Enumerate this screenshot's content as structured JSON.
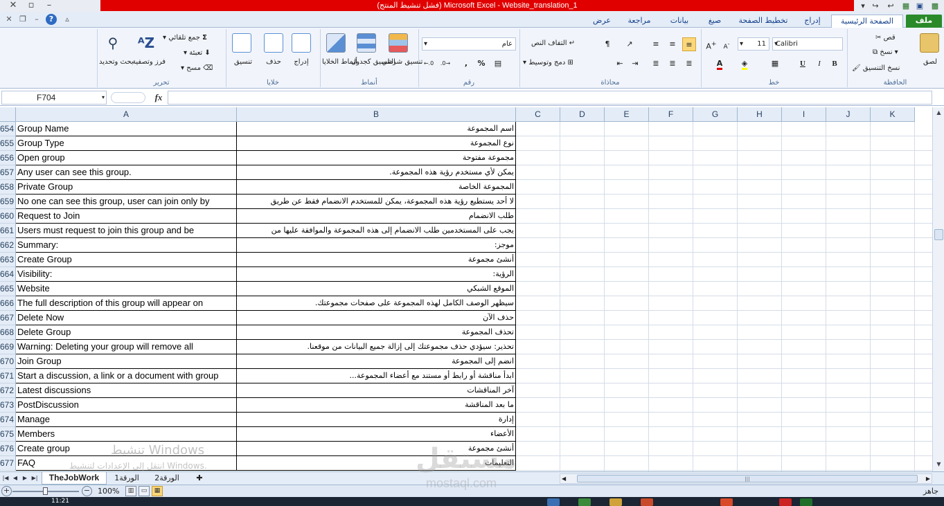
{
  "window": {
    "title": "(فشل تنشيط المنتج) Microsoft Excel - Website_translation_1",
    "minimize": "–",
    "restore": "▫",
    "close": "✕"
  },
  "tabs": {
    "file": "ملف",
    "home": "الصفحة الرئيسية",
    "insert": "إدراج",
    "page_layout": "تخطيط الصفحة",
    "formulas": "صيغ",
    "data": "بيانات",
    "review": "مراجعة",
    "view": "عرض"
  },
  "ribbon": {
    "clipboard": {
      "label": "الحافظة",
      "paste": "لصق",
      "cut": "قص",
      "copy": "نسخ",
      "format_painter": "نسخ التنسيق"
    },
    "font": {
      "label": "خط",
      "font_name": "Calibri",
      "font_size": "11",
      "bold": "B",
      "italic": "I",
      "underline": "U"
    },
    "alignment": {
      "label": "محاذاة",
      "wrap_text": "التفاف النص",
      "merge_center": "دمج وتوسيط"
    },
    "number": {
      "label": "رقم",
      "format": "عام",
      "percent": "%",
      "comma": ","
    },
    "styles": {
      "label": "أنماط",
      "conditional": "تنسيق شرطي",
      "format_table": "التنسيق كجدول",
      "cell_styles": "أنماط الخلايا"
    },
    "cells": {
      "label": "خلايا",
      "insert": "إدراج",
      "delete": "حذف",
      "format": "تنسيق"
    },
    "editing": {
      "label": "تحرير",
      "autosum": "جمع تلقائي",
      "fill": "تعبئة",
      "clear": "مسح",
      "sort_filter": "فرز وتصفية",
      "find_select": "بحث وتحديد"
    }
  },
  "formula_bar": {
    "name_box": "F704",
    "fx": "fx",
    "value": ""
  },
  "columns": [
    "A",
    "B",
    "C",
    "D",
    "E",
    "F",
    "G",
    "H",
    "I",
    "J",
    "K"
  ],
  "rows": [
    {
      "num": "654",
      "a": "Group Name",
      "b": "اسم المجموعة"
    },
    {
      "num": "655",
      "a": "Group Type",
      "b": "نوع المجموعة"
    },
    {
      "num": "656",
      "a": "Open group",
      "b": "مجموعة مفتوحة"
    },
    {
      "num": "657",
      "a": "Any user can see this group.",
      "b": "يمكن لأي مستخدم رؤية هذه المجموعة."
    },
    {
      "num": "658",
      "a": "Private Group",
      "b": "المجموعة الخاصة"
    },
    {
      "num": "659",
      "a": "No one can see this group, user can join only by",
      "b": "لا أحد يستطيع رؤية هذه المجموعة، يمكن للمستخدم الانضمام فقط عن طريق"
    },
    {
      "num": "660",
      "a": "Request to Join",
      "b": "طلب الانضمام"
    },
    {
      "num": "661",
      "a": "Users must request to join this group and be",
      "b": "يجب على المستخدمين طلب الانضمام إلى هذه المجموعة والموافقة عليها من"
    },
    {
      "num": "662",
      "a": "Summary:",
      "b": "موجز:"
    },
    {
      "num": "663",
      "a": "Create Group",
      "b": "أنشئ مجموعة"
    },
    {
      "num": "664",
      "a": "Visibility:",
      "b": "الرؤية:"
    },
    {
      "num": "665",
      "a": "Website",
      "b": "الموقع الشبكي"
    },
    {
      "num": "666",
      "a": "The full description of this group will appear on",
      "b": "سيظهر الوصف الكامل لهذه المجموعة على صفحات مجموعتك."
    },
    {
      "num": "667",
      "a": "Delete Now",
      "b": "حذف الآن"
    },
    {
      "num": "668",
      "a": "Delete Group",
      "b": "تحذف المجموعة"
    },
    {
      "num": "669",
      "a": "Warning: Deleting your group will remove all",
      "b": "تحذير: سيؤدي حذف مجموعتك إلى إزالة جميع البيانات من موقعنا."
    },
    {
      "num": "670",
      "a": "Join Group",
      "b": "انضم إلى المجموعة"
    },
    {
      "num": "671",
      "a": "Start a discussion, a link or a document with group",
      "b": "ابدأ مناقشة أو رابط أو مستند مع أعضاء المجموعة..."
    },
    {
      "num": "672",
      "a": "Latest discussions",
      "b": "آخر المناقشات"
    },
    {
      "num": "673",
      "a": "PostDiscussion",
      "b": "ما بعد المناقشة"
    },
    {
      "num": "674",
      "a": "Manage",
      "b": "إدارة"
    },
    {
      "num": "675",
      "a": "Members",
      "b": "الأعضاء"
    },
    {
      "num": "676",
      "a": "Create group",
      "b": "أنشئ مجموعة"
    },
    {
      "num": "677",
      "a": "FAQ",
      "b": "التعليمات"
    }
  ],
  "sheets": {
    "active": "TheJobWork",
    "sheet1": "الورقة1",
    "sheet2": "الورقة2"
  },
  "status": {
    "zoom": "100%",
    "ready": "جاهز",
    "clock": "11:21"
  },
  "watermarks": {
    "activate_title": "تنشيط Windows",
    "activate_sub": "انتقل إلى الإعدادات لتنشيط Windows.",
    "logo": "مستقل",
    "url": "mostaql.com"
  }
}
